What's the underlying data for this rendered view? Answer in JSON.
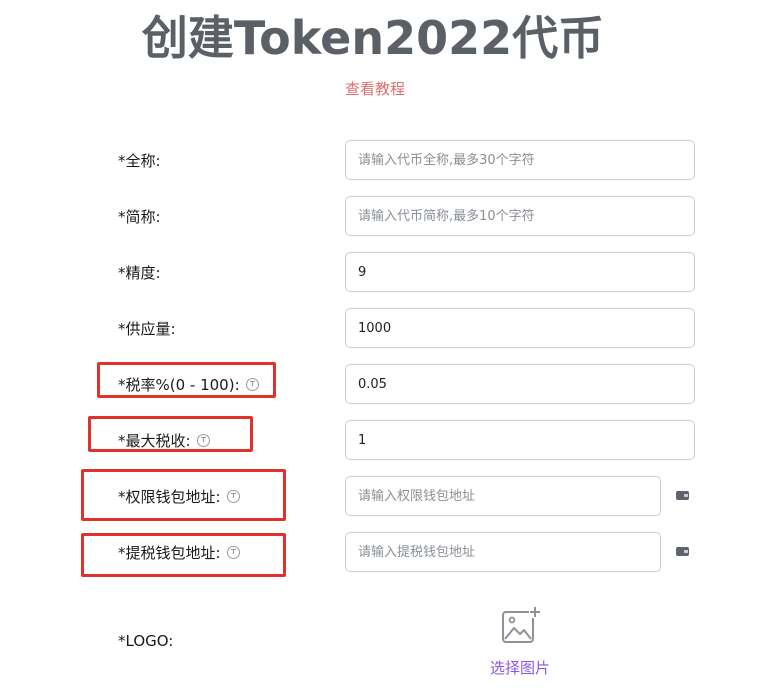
{
  "page": {
    "title": "创建Token2022代币",
    "tutorial_link": "查看教程"
  },
  "form": {
    "full_name": {
      "label": "*全称:",
      "placeholder": "请输入代币全称,最多30个字符",
      "value": ""
    },
    "short_name": {
      "label": "*简称:",
      "placeholder": "请输入代币简称,最多10个字符",
      "value": ""
    },
    "precision": {
      "label": "*精度:",
      "value": "9"
    },
    "supply": {
      "label": "*供应量:",
      "value": "1000"
    },
    "tax_rate": {
      "label": "*税率%(0 - 100):",
      "value": "0.05"
    },
    "max_tax": {
      "label": "*最大税收:",
      "value": "1"
    },
    "authority_wallet": {
      "label": "*权限钱包地址:",
      "placeholder": "请输入权限钱包地址",
      "value": ""
    },
    "withdraw_wallet": {
      "label": "*提税钱包地址:",
      "placeholder": "请输入提税钱包地址",
      "value": ""
    },
    "logo": {
      "label": "*LOGO:",
      "button_label": "选择图片"
    }
  },
  "icons": {
    "help": "help-circle-icon",
    "wallet": "wallet-icon",
    "image_add": "image-add-icon"
  },
  "colors": {
    "title": "#5b5f66",
    "tutorial_link": "#e16e6e",
    "highlight_box": "#e0322c",
    "pick_image": "#8e55e8"
  }
}
